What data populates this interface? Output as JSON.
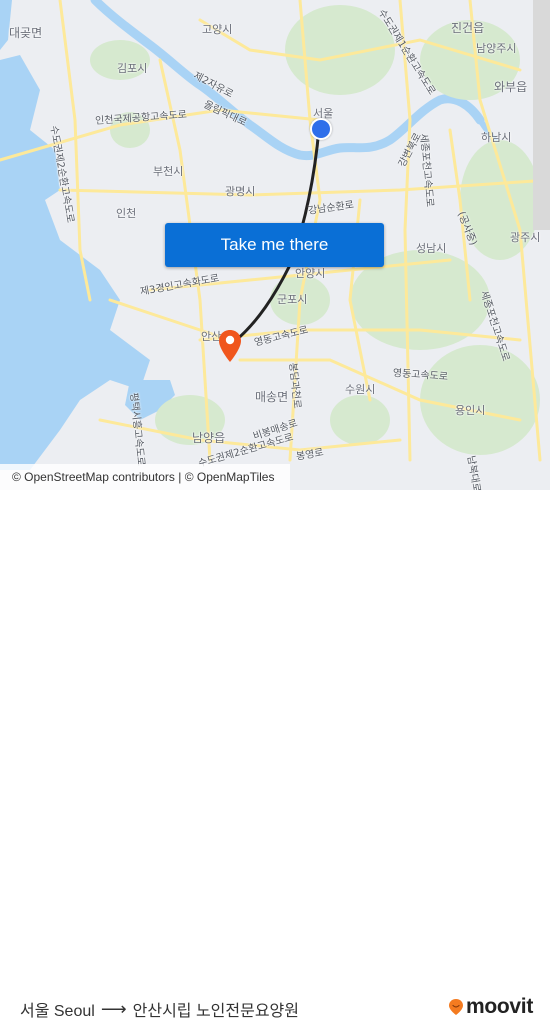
{
  "map": {
    "attribution": "© OpenStreetMap contributors | © OpenMapTiles",
    "colors": {
      "land": "#eceef2",
      "water": "#a9d3f5",
      "green": "#d6e9cf",
      "road": "#fde99a",
      "route_line": "#222222",
      "origin_marker": "#2f6fea",
      "destination_marker": "#f0561d",
      "cta_button": "#0a6fd6"
    },
    "place_labels": [
      {
        "id": "daegot",
        "text": "대곶면"
      },
      {
        "id": "goyang",
        "text": "고양시"
      },
      {
        "id": "gimpo",
        "text": "김포시"
      },
      {
        "id": "jingeon",
        "text": "진건읍"
      },
      {
        "id": "namyangju",
        "text": "남양주시"
      },
      {
        "id": "wabu",
        "text": "와부읍"
      },
      {
        "id": "seoul",
        "text": "서울"
      },
      {
        "id": "hanam",
        "text": "하남시"
      },
      {
        "id": "bucheon",
        "text": "부천시"
      },
      {
        "id": "gwangmyeong",
        "text": "광명시"
      },
      {
        "id": "incheon",
        "text": "인천"
      },
      {
        "id": "seongnam",
        "text": "성남시"
      },
      {
        "id": "gwangju",
        "text": "광주시"
      },
      {
        "id": "anyang",
        "text": "안양시"
      },
      {
        "id": "gunpo",
        "text": "군포시"
      },
      {
        "id": "ansan",
        "text": "안산"
      },
      {
        "id": "maesong",
        "text": "매송면"
      },
      {
        "id": "suwon",
        "text": "수원시"
      },
      {
        "id": "yongin",
        "text": "용인시"
      },
      {
        "id": "namyang",
        "text": "남양읍"
      }
    ],
    "road_labels": [
      {
        "id": "jayuro",
        "text": "제2자유로"
      },
      {
        "id": "olympic",
        "text": "올림픽대로"
      },
      {
        "id": "airport",
        "text": "인천국제공항고속도로"
      },
      {
        "id": "sudo2",
        "text": "수도권제2순환고속도로"
      },
      {
        "id": "sudo1",
        "text": "수도권제1순환고속도로"
      },
      {
        "id": "gangbyeon",
        "text": "강변북로"
      },
      {
        "id": "sejong",
        "text": "세종포천고속도로"
      },
      {
        "id": "gangnam",
        "text": "강남순환로"
      },
      {
        "id": "gongsa",
        "text": "(공사중)"
      },
      {
        "id": "third",
        "text": "제3경인고속화도로"
      },
      {
        "id": "yeongdong1",
        "text": "영동고속도로"
      },
      {
        "id": "yeongdong2",
        "text": "영동고속도로"
      },
      {
        "id": "sejong2",
        "text": "세종포천고속도로"
      },
      {
        "id": "pyeongtaek",
        "text": "평택시흥고속도로"
      },
      {
        "id": "bibong",
        "text": "비봉매송로"
      },
      {
        "id": "bongyeong",
        "text": "봉영로"
      },
      {
        "id": "gwacheon",
        "text": "봉담과천로"
      },
      {
        "id": "sudo2b",
        "text": "수도권제2순환고속도로"
      },
      {
        "id": "nambuk",
        "text": "남북대로"
      }
    ],
    "cta_label": "Take me there"
  },
  "footer": {
    "origin": "서울 Seoul",
    "arrow": "⟶",
    "destination": "안산시립 노인전문요양원",
    "brand": "moovit"
  }
}
